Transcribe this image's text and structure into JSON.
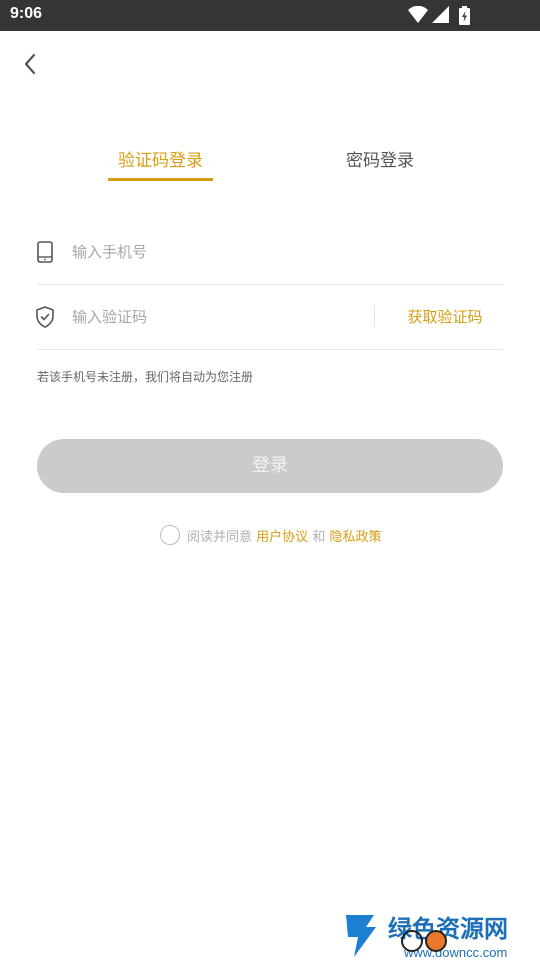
{
  "status_bar": {
    "time": "9:06"
  },
  "tabs": [
    {
      "label": "验证码登录",
      "active": true
    },
    {
      "label": "密码登录",
      "active": false
    }
  ],
  "phone": {
    "placeholder": "输入手机号",
    "value": ""
  },
  "code": {
    "placeholder": "输入验证码",
    "value": "",
    "get_code_label": "获取验证码"
  },
  "hint": "若该手机号未注册，我们将自动为您注册",
  "login_button": {
    "label": "登录"
  },
  "agreement": {
    "prefix": "阅读并同意",
    "user_agreement": "用户协议",
    "conjunction": "和",
    "privacy_policy": "隐私政策",
    "checked": false
  },
  "watermark": {
    "brand": "绿色资源网",
    "site": "www.downcc.com"
  },
  "colors": {
    "accent": "#d69e13",
    "status_bar": "#353535",
    "button_disabled": "#cbcbcb"
  }
}
